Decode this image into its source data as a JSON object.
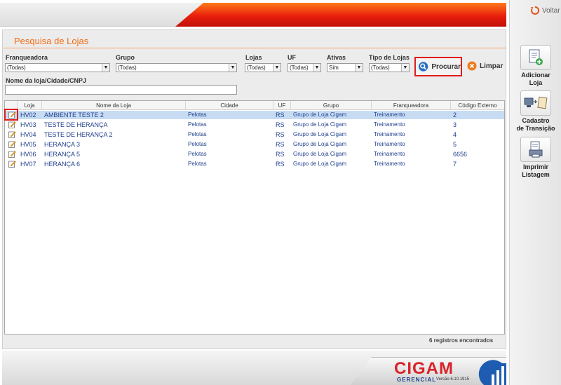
{
  "header": {
    "voltar_label": "Voltar"
  },
  "sidebar": {
    "items": [
      {
        "label_line1": "Adicionar",
        "label_line2": "Loja"
      },
      {
        "label_line1": "Cadastro",
        "label_line2": "de Transição"
      },
      {
        "label_line1": "Imprimir",
        "label_line2": "Listagem"
      }
    ]
  },
  "panel": {
    "title": "Pesquisa de Lojas"
  },
  "filters": {
    "franqueadora": {
      "label": "Franqueadora",
      "value": "(Todas)"
    },
    "grupo": {
      "label": "Grupo",
      "value": "(Todas)"
    },
    "lojas": {
      "label": "Lojas",
      "value": "(Todas)"
    },
    "uf": {
      "label": "UF",
      "value": "(Todas)"
    },
    "ativas": {
      "label": "Ativas",
      "value": "Sim"
    },
    "tipo_lojas": {
      "label": "Tipo de Lojas",
      "value": "(Todas)"
    },
    "nome_loja": {
      "label": "Nome da loja/Cidade/CNPJ",
      "value": ""
    },
    "procurar_label": "Procurar",
    "limpar_label": "Limpar"
  },
  "table": {
    "columns": [
      "Loja",
      "Nome da Loja",
      "Cidade",
      "UF",
      "Grupo",
      "Franqueadora",
      "Código Externo"
    ],
    "rows": [
      {
        "loja": "HV02",
        "nome": "AMBIENTE TESTE 2",
        "cidade": "Pelotas",
        "uf": "RS",
        "grupo": "Grupo de Loja Cigam",
        "franqueadora": "Treinamento",
        "codigo": "2"
      },
      {
        "loja": "HV03",
        "nome": "TESTE DE HERANÇA",
        "cidade": "Pelotas",
        "uf": "RS",
        "grupo": "Grupo de Loja Cigam",
        "franqueadora": "Treinamento",
        "codigo": "3"
      },
      {
        "loja": "HV04",
        "nome": "TESTE DE HERANÇA 2",
        "cidade": "Pelotas",
        "uf": "RS",
        "grupo": "Grupo de Loja Cigam",
        "franqueadora": "Treinamento",
        "codigo": "4"
      },
      {
        "loja": "HV05",
        "nome": "HERANÇA 3",
        "cidade": "Pelotas",
        "uf": "RS",
        "grupo": "Grupo de Loja Cigam",
        "franqueadora": "Treinamento",
        "codigo": "5"
      },
      {
        "loja": "HV06",
        "nome": "HERANÇA 5",
        "cidade": "Pelotas",
        "uf": "RS",
        "grupo": "Grupo de Loja Cigam",
        "franqueadora": "Treinamento",
        "codigo": "6656"
      },
      {
        "loja": "HV07",
        "nome": "HERANÇA 6",
        "cidade": "Pelotas",
        "uf": "RS",
        "grupo": "Grupo de Loja Cigam",
        "franqueadora": "Treinamento",
        "codigo": "7"
      }
    ],
    "records_text": "6 registros encontrados"
  },
  "footer": {
    "brand": "CIGAM",
    "product": "GERENCIAL",
    "version": "Versão 6.10.1915"
  },
  "colors": {
    "accent": "#f26b12",
    "highlight": "#e21b1b",
    "selected_row": "#c7dcf3"
  }
}
